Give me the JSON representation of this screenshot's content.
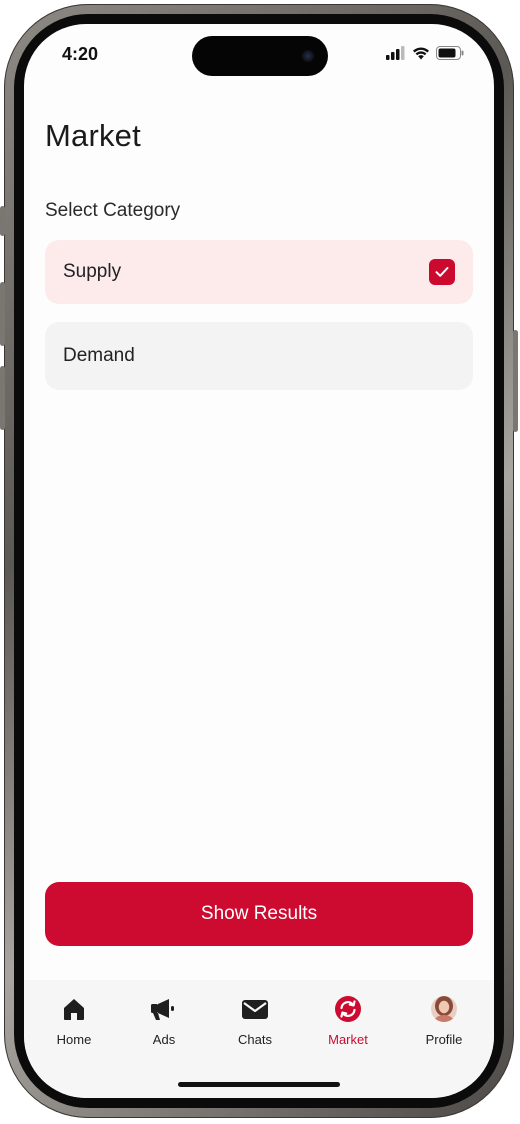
{
  "status_bar": {
    "time": "4:20"
  },
  "page": {
    "title": "Market",
    "section_label": "Select Category"
  },
  "options": [
    {
      "label": "Supply",
      "checked": true
    },
    {
      "label": "Demand",
      "checked": false
    }
  ],
  "primary_button": {
    "label": "Show Results"
  },
  "tab_bar": {
    "items": [
      {
        "label": "Home",
        "icon": "home-icon"
      },
      {
        "label": "Ads",
        "icon": "megaphone-icon"
      },
      {
        "label": "Chats",
        "icon": "envelope-icon"
      },
      {
        "label": "Market",
        "icon": "sync-icon",
        "active": true
      },
      {
        "label": "Profile",
        "icon": "avatar"
      }
    ]
  },
  "colors": {
    "accent": "#cd0a30",
    "selected_option_bg": "#fdebec",
    "option_bg": "#f3f3f3"
  }
}
